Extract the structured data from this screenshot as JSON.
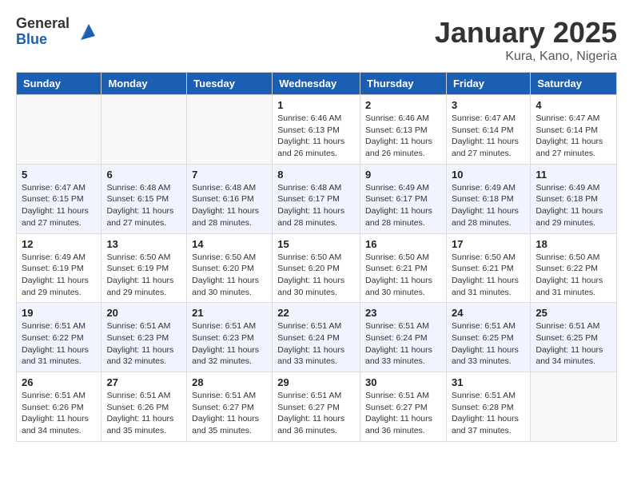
{
  "logo": {
    "general": "General",
    "blue": "Blue"
  },
  "title": "January 2025",
  "location": "Kura, Kano, Nigeria",
  "weekdays": [
    "Sunday",
    "Monday",
    "Tuesday",
    "Wednesday",
    "Thursday",
    "Friday",
    "Saturday"
  ],
  "weeks": [
    [
      {
        "day": "",
        "info": ""
      },
      {
        "day": "",
        "info": ""
      },
      {
        "day": "",
        "info": ""
      },
      {
        "day": "1",
        "info": "Sunrise: 6:46 AM\nSunset: 6:13 PM\nDaylight: 11 hours\nand 26 minutes."
      },
      {
        "day": "2",
        "info": "Sunrise: 6:46 AM\nSunset: 6:13 PM\nDaylight: 11 hours\nand 26 minutes."
      },
      {
        "day": "3",
        "info": "Sunrise: 6:47 AM\nSunset: 6:14 PM\nDaylight: 11 hours\nand 27 minutes."
      },
      {
        "day": "4",
        "info": "Sunrise: 6:47 AM\nSunset: 6:14 PM\nDaylight: 11 hours\nand 27 minutes."
      }
    ],
    [
      {
        "day": "5",
        "info": "Sunrise: 6:47 AM\nSunset: 6:15 PM\nDaylight: 11 hours\nand 27 minutes."
      },
      {
        "day": "6",
        "info": "Sunrise: 6:48 AM\nSunset: 6:15 PM\nDaylight: 11 hours\nand 27 minutes."
      },
      {
        "day": "7",
        "info": "Sunrise: 6:48 AM\nSunset: 6:16 PM\nDaylight: 11 hours\nand 28 minutes."
      },
      {
        "day": "8",
        "info": "Sunrise: 6:48 AM\nSunset: 6:17 PM\nDaylight: 11 hours\nand 28 minutes."
      },
      {
        "day": "9",
        "info": "Sunrise: 6:49 AM\nSunset: 6:17 PM\nDaylight: 11 hours\nand 28 minutes."
      },
      {
        "day": "10",
        "info": "Sunrise: 6:49 AM\nSunset: 6:18 PM\nDaylight: 11 hours\nand 28 minutes."
      },
      {
        "day": "11",
        "info": "Sunrise: 6:49 AM\nSunset: 6:18 PM\nDaylight: 11 hours\nand 29 minutes."
      }
    ],
    [
      {
        "day": "12",
        "info": "Sunrise: 6:49 AM\nSunset: 6:19 PM\nDaylight: 11 hours\nand 29 minutes."
      },
      {
        "day": "13",
        "info": "Sunrise: 6:50 AM\nSunset: 6:19 PM\nDaylight: 11 hours\nand 29 minutes."
      },
      {
        "day": "14",
        "info": "Sunrise: 6:50 AM\nSunset: 6:20 PM\nDaylight: 11 hours\nand 30 minutes."
      },
      {
        "day": "15",
        "info": "Sunrise: 6:50 AM\nSunset: 6:20 PM\nDaylight: 11 hours\nand 30 minutes."
      },
      {
        "day": "16",
        "info": "Sunrise: 6:50 AM\nSunset: 6:21 PM\nDaylight: 11 hours\nand 30 minutes."
      },
      {
        "day": "17",
        "info": "Sunrise: 6:50 AM\nSunset: 6:21 PM\nDaylight: 11 hours\nand 31 minutes."
      },
      {
        "day": "18",
        "info": "Sunrise: 6:50 AM\nSunset: 6:22 PM\nDaylight: 11 hours\nand 31 minutes."
      }
    ],
    [
      {
        "day": "19",
        "info": "Sunrise: 6:51 AM\nSunset: 6:22 PM\nDaylight: 11 hours\nand 31 minutes."
      },
      {
        "day": "20",
        "info": "Sunrise: 6:51 AM\nSunset: 6:23 PM\nDaylight: 11 hours\nand 32 minutes."
      },
      {
        "day": "21",
        "info": "Sunrise: 6:51 AM\nSunset: 6:23 PM\nDaylight: 11 hours\nand 32 minutes."
      },
      {
        "day": "22",
        "info": "Sunrise: 6:51 AM\nSunset: 6:24 PM\nDaylight: 11 hours\nand 33 minutes."
      },
      {
        "day": "23",
        "info": "Sunrise: 6:51 AM\nSunset: 6:24 PM\nDaylight: 11 hours\nand 33 minutes."
      },
      {
        "day": "24",
        "info": "Sunrise: 6:51 AM\nSunset: 6:25 PM\nDaylight: 11 hours\nand 33 minutes."
      },
      {
        "day": "25",
        "info": "Sunrise: 6:51 AM\nSunset: 6:25 PM\nDaylight: 11 hours\nand 34 minutes."
      }
    ],
    [
      {
        "day": "26",
        "info": "Sunrise: 6:51 AM\nSunset: 6:26 PM\nDaylight: 11 hours\nand 34 minutes."
      },
      {
        "day": "27",
        "info": "Sunrise: 6:51 AM\nSunset: 6:26 PM\nDaylight: 11 hours\nand 35 minutes."
      },
      {
        "day": "28",
        "info": "Sunrise: 6:51 AM\nSunset: 6:27 PM\nDaylight: 11 hours\nand 35 minutes."
      },
      {
        "day": "29",
        "info": "Sunrise: 6:51 AM\nSunset: 6:27 PM\nDaylight: 11 hours\nand 36 minutes."
      },
      {
        "day": "30",
        "info": "Sunrise: 6:51 AM\nSunset: 6:27 PM\nDaylight: 11 hours\nand 36 minutes."
      },
      {
        "day": "31",
        "info": "Sunrise: 6:51 AM\nSunset: 6:28 PM\nDaylight: 11 hours\nand 37 minutes."
      },
      {
        "day": "",
        "info": ""
      }
    ]
  ]
}
